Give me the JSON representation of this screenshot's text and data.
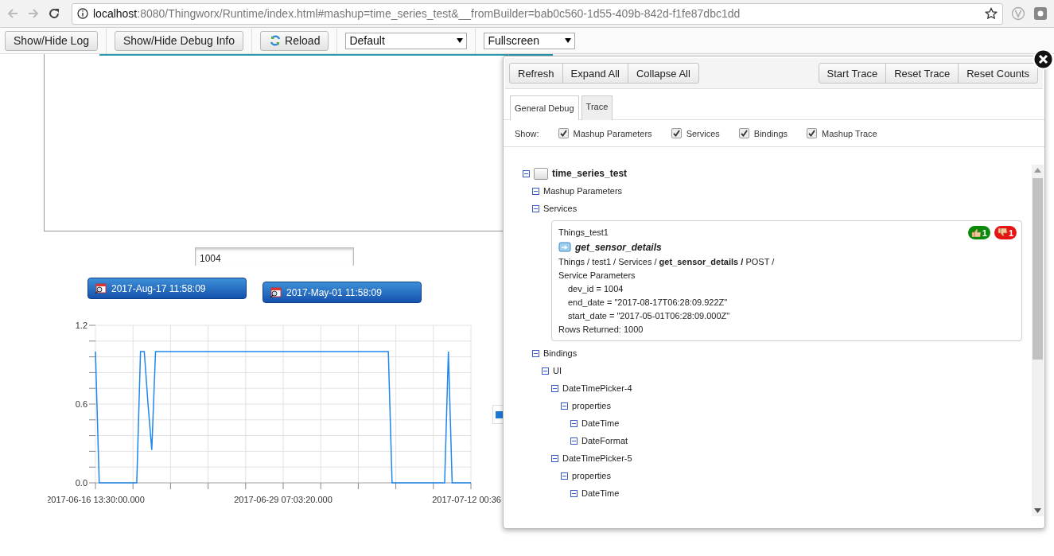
{
  "browser": {
    "url_host": "localhost",
    "url_rest": ":8080/Thingworx/Runtime/index.html#mashup=time_series_test&__fromBuilder=bab0c560-1d55-409b-842d-f1fe87dbc1dd"
  },
  "toolbar": {
    "buttons": [
      {
        "label": "Show/Hide Log",
        "kind": "plain"
      },
      {
        "label": "Show/Hide Debug Info",
        "kind": "plain"
      },
      {
        "label": "Reload",
        "kind": "reload"
      }
    ],
    "selects": [
      {
        "value": "Default"
      },
      {
        "value": "Fullscreen"
      }
    ]
  },
  "mashup": {
    "input": {
      "value": "1004"
    },
    "date_pickers": [
      {
        "value": "2017-Aug-17 11:58:09"
      },
      {
        "value": "2017-May-01 11:58:09"
      }
    ],
    "chart_data": {
      "type": "line",
      "categories": [
        "2017-06-16 13:30:00.000",
        null,
        null,
        null,
        null,
        null,
        null,
        null,
        null,
        null,
        null,
        null,
        null,
        null,
        null,
        null,
        null,
        null,
        null,
        null,
        null,
        null,
        null,
        null,
        null,
        null,
        null,
        null,
        null,
        null,
        null,
        null,
        null,
        null,
        null,
        null,
        null,
        null,
        null,
        null,
        null,
        null,
        null,
        null,
        null,
        null,
        null,
        null,
        null,
        null,
        "2017-06-29 07:03:20.000",
        null,
        null,
        null,
        null,
        null,
        null,
        null,
        null,
        null,
        null,
        null,
        null,
        null,
        null,
        null,
        null,
        null,
        null,
        null,
        null,
        null,
        null,
        null,
        null,
        null,
        null,
        null,
        null,
        null,
        null,
        null,
        null,
        null,
        null,
        null,
        null,
        null,
        null,
        null,
        null,
        null,
        null,
        null,
        null,
        null,
        null,
        null,
        null,
        null,
        "2017-07-12 00:36"
      ],
      "series": [
        {
          "color": "#1e88f0",
          "values": [
            1,
            0,
            0,
            0,
            0,
            0,
            0,
            0,
            0,
            0,
            0,
            0,
            1,
            1,
            0.6,
            0.25,
            1,
            1,
            1,
            1,
            1,
            1,
            1,
            1,
            1,
            1,
            1,
            1,
            1,
            1,
            1,
            1,
            1,
            1,
            1,
            1,
            1,
            1,
            1,
            1,
            1,
            1,
            1,
            1,
            1,
            1,
            1,
            1,
            1,
            1,
            1,
            1,
            1,
            1,
            1,
            1,
            1,
            1,
            1,
            1,
            1,
            1,
            1,
            1,
            1,
            1,
            1,
            1,
            1,
            1,
            1,
            1,
            1,
            1,
            1,
            1,
            1,
            1,
            1,
            0,
            0,
            0,
            0,
            0,
            0,
            0,
            0,
            0,
            0,
            0,
            0,
            0,
            0,
            0,
            1,
            0,
            0,
            0,
            0,
            0,
            0
          ]
        }
      ],
      "grid": true,
      "ylim": [
        0,
        1.2
      ],
      "yticks": [
        {
          "value": 0,
          "label": "0.0"
        },
        {
          "value": 0.6,
          "label": "0.6"
        },
        {
          "value": 1.2,
          "label": "1.2"
        }
      ]
    }
  },
  "debug_panel": {
    "left_buttons": [
      "Refresh",
      "Expand All",
      "Collapse All"
    ],
    "right_buttons": [
      "Start Trace",
      "Reset Trace",
      "Reset Counts"
    ],
    "tabs": [
      {
        "label": "General Debug",
        "selected": true
      },
      {
        "label": "Trace",
        "selected": false
      }
    ],
    "show_label": "Show:",
    "show_options": [
      {
        "label": "Mashup Parameters",
        "checked": true
      },
      {
        "label": "Services",
        "checked": true
      },
      {
        "label": "Bindings",
        "checked": true
      },
      {
        "label": "Mashup Trace",
        "checked": true
      }
    ],
    "tree": [
      {
        "label": "time_series_test",
        "expanded": true,
        "children": [
          {
            "label": "Mashup Parameters",
            "expanded": true
          },
          {
            "label": "Services",
            "expanded": true,
            "card": {
              "thing": "Things_test1",
              "service": "get_sensor_details",
              "path": "Things / test1 / Services / **get_sensor_details /** POST /",
              "params_title": "Service Parameters",
              "params": [
                "dev_id = 1004",
                "end_date = \"2017-08-17T06:28:09.922Z\"",
                "start_date = \"2017-05-01T06:28:09.000Z\""
              ],
              "rows": "Rows Returned: 1000",
              "success_count": "1",
              "failure_count": "1"
            }
          },
          {
            "label": "Bindings",
            "expanded": true,
            "children": [
              {
                "label": "UI",
                "expanded": true,
                "children": [
                  {
                    "label": "DateTimePicker-4",
                    "expanded": true,
                    "children": [
                      {
                        "label": "properties",
                        "expanded": true,
                        "children": [
                          {
                            "label": "DateTime",
                            "expanded": true
                          },
                          {
                            "label": "DateFormat",
                            "expanded": true
                          }
                        ]
                      }
                    ]
                  },
                  {
                    "label": "DateTimePicker-5",
                    "expanded": true,
                    "children": [
                      {
                        "label": "properties",
                        "expanded": true,
                        "children": [
                          {
                            "label": "DateTime",
                            "expanded": true
                          }
                        ]
                      }
                    ]
                  }
                ]
              }
            ]
          }
        ]
      }
    ]
  }
}
